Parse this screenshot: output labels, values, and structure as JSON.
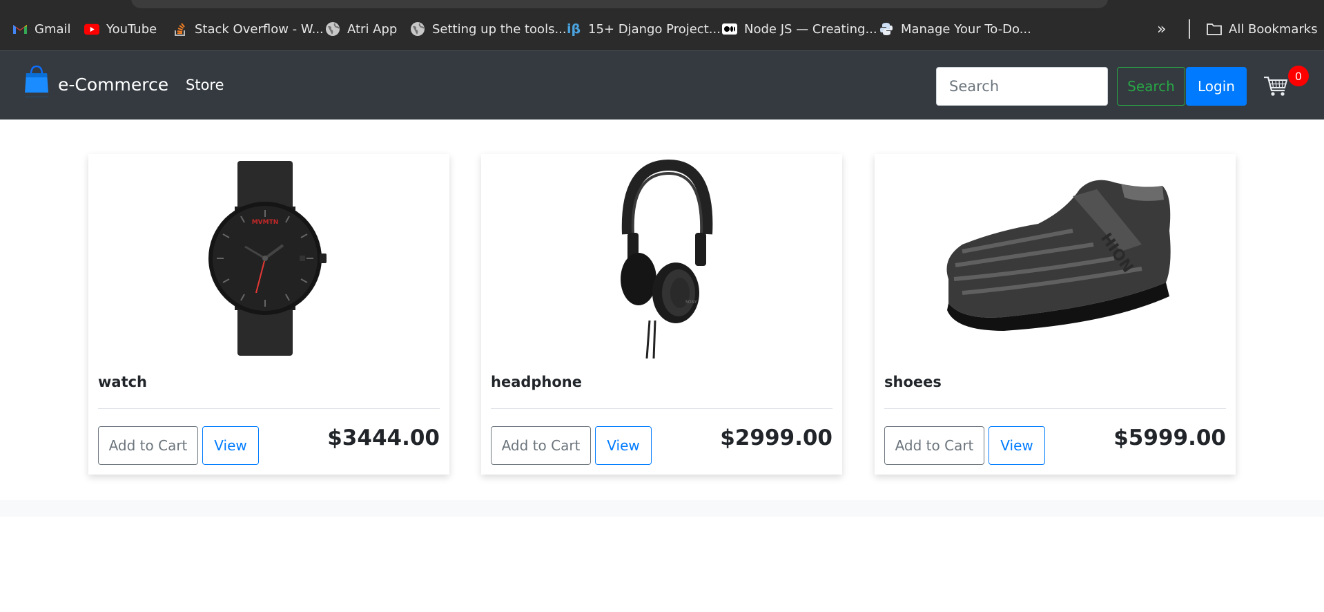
{
  "bookmarks": [
    {
      "label": "Gmail",
      "icon": "gmail-icon"
    },
    {
      "label": "YouTube",
      "icon": "youtube-icon"
    },
    {
      "label": "Stack Overflow - W...",
      "icon": "stackoverflow-icon"
    },
    {
      "label": "Atri App",
      "icon": "globe-icon"
    },
    {
      "label": "Setting up the tools...",
      "icon": "globe-icon"
    },
    {
      "label": "15+ Django Project...",
      "icon": "ib-icon"
    },
    {
      "label": "Node JS — Creating...",
      "icon": "medium-icon"
    },
    {
      "label": "Manage Your To-Do...",
      "icon": "python-icon"
    }
  ],
  "bookmarks_more": "»",
  "all_bookmarks": "All Bookmarks",
  "navbar": {
    "brand": "e-Commerce",
    "store_link": "Store",
    "search_placeholder": "Search",
    "search_button": "Search",
    "login_button": "Login",
    "cart_count": "0"
  },
  "products": [
    {
      "title": "watch",
      "price": "$3444.00",
      "add_label": "Add to Cart",
      "view_label": "View"
    },
    {
      "title": "headphone",
      "price": "$2999.00",
      "add_label": "Add to Cart",
      "view_label": "View"
    },
    {
      "title": "shoees",
      "price": "$5999.00",
      "add_label": "Add to Cart",
      "view_label": "View"
    }
  ],
  "colors": {
    "navbar_bg": "#343a40",
    "primary": "#007bff",
    "success": "#28a745",
    "badge": "#ff0000"
  }
}
